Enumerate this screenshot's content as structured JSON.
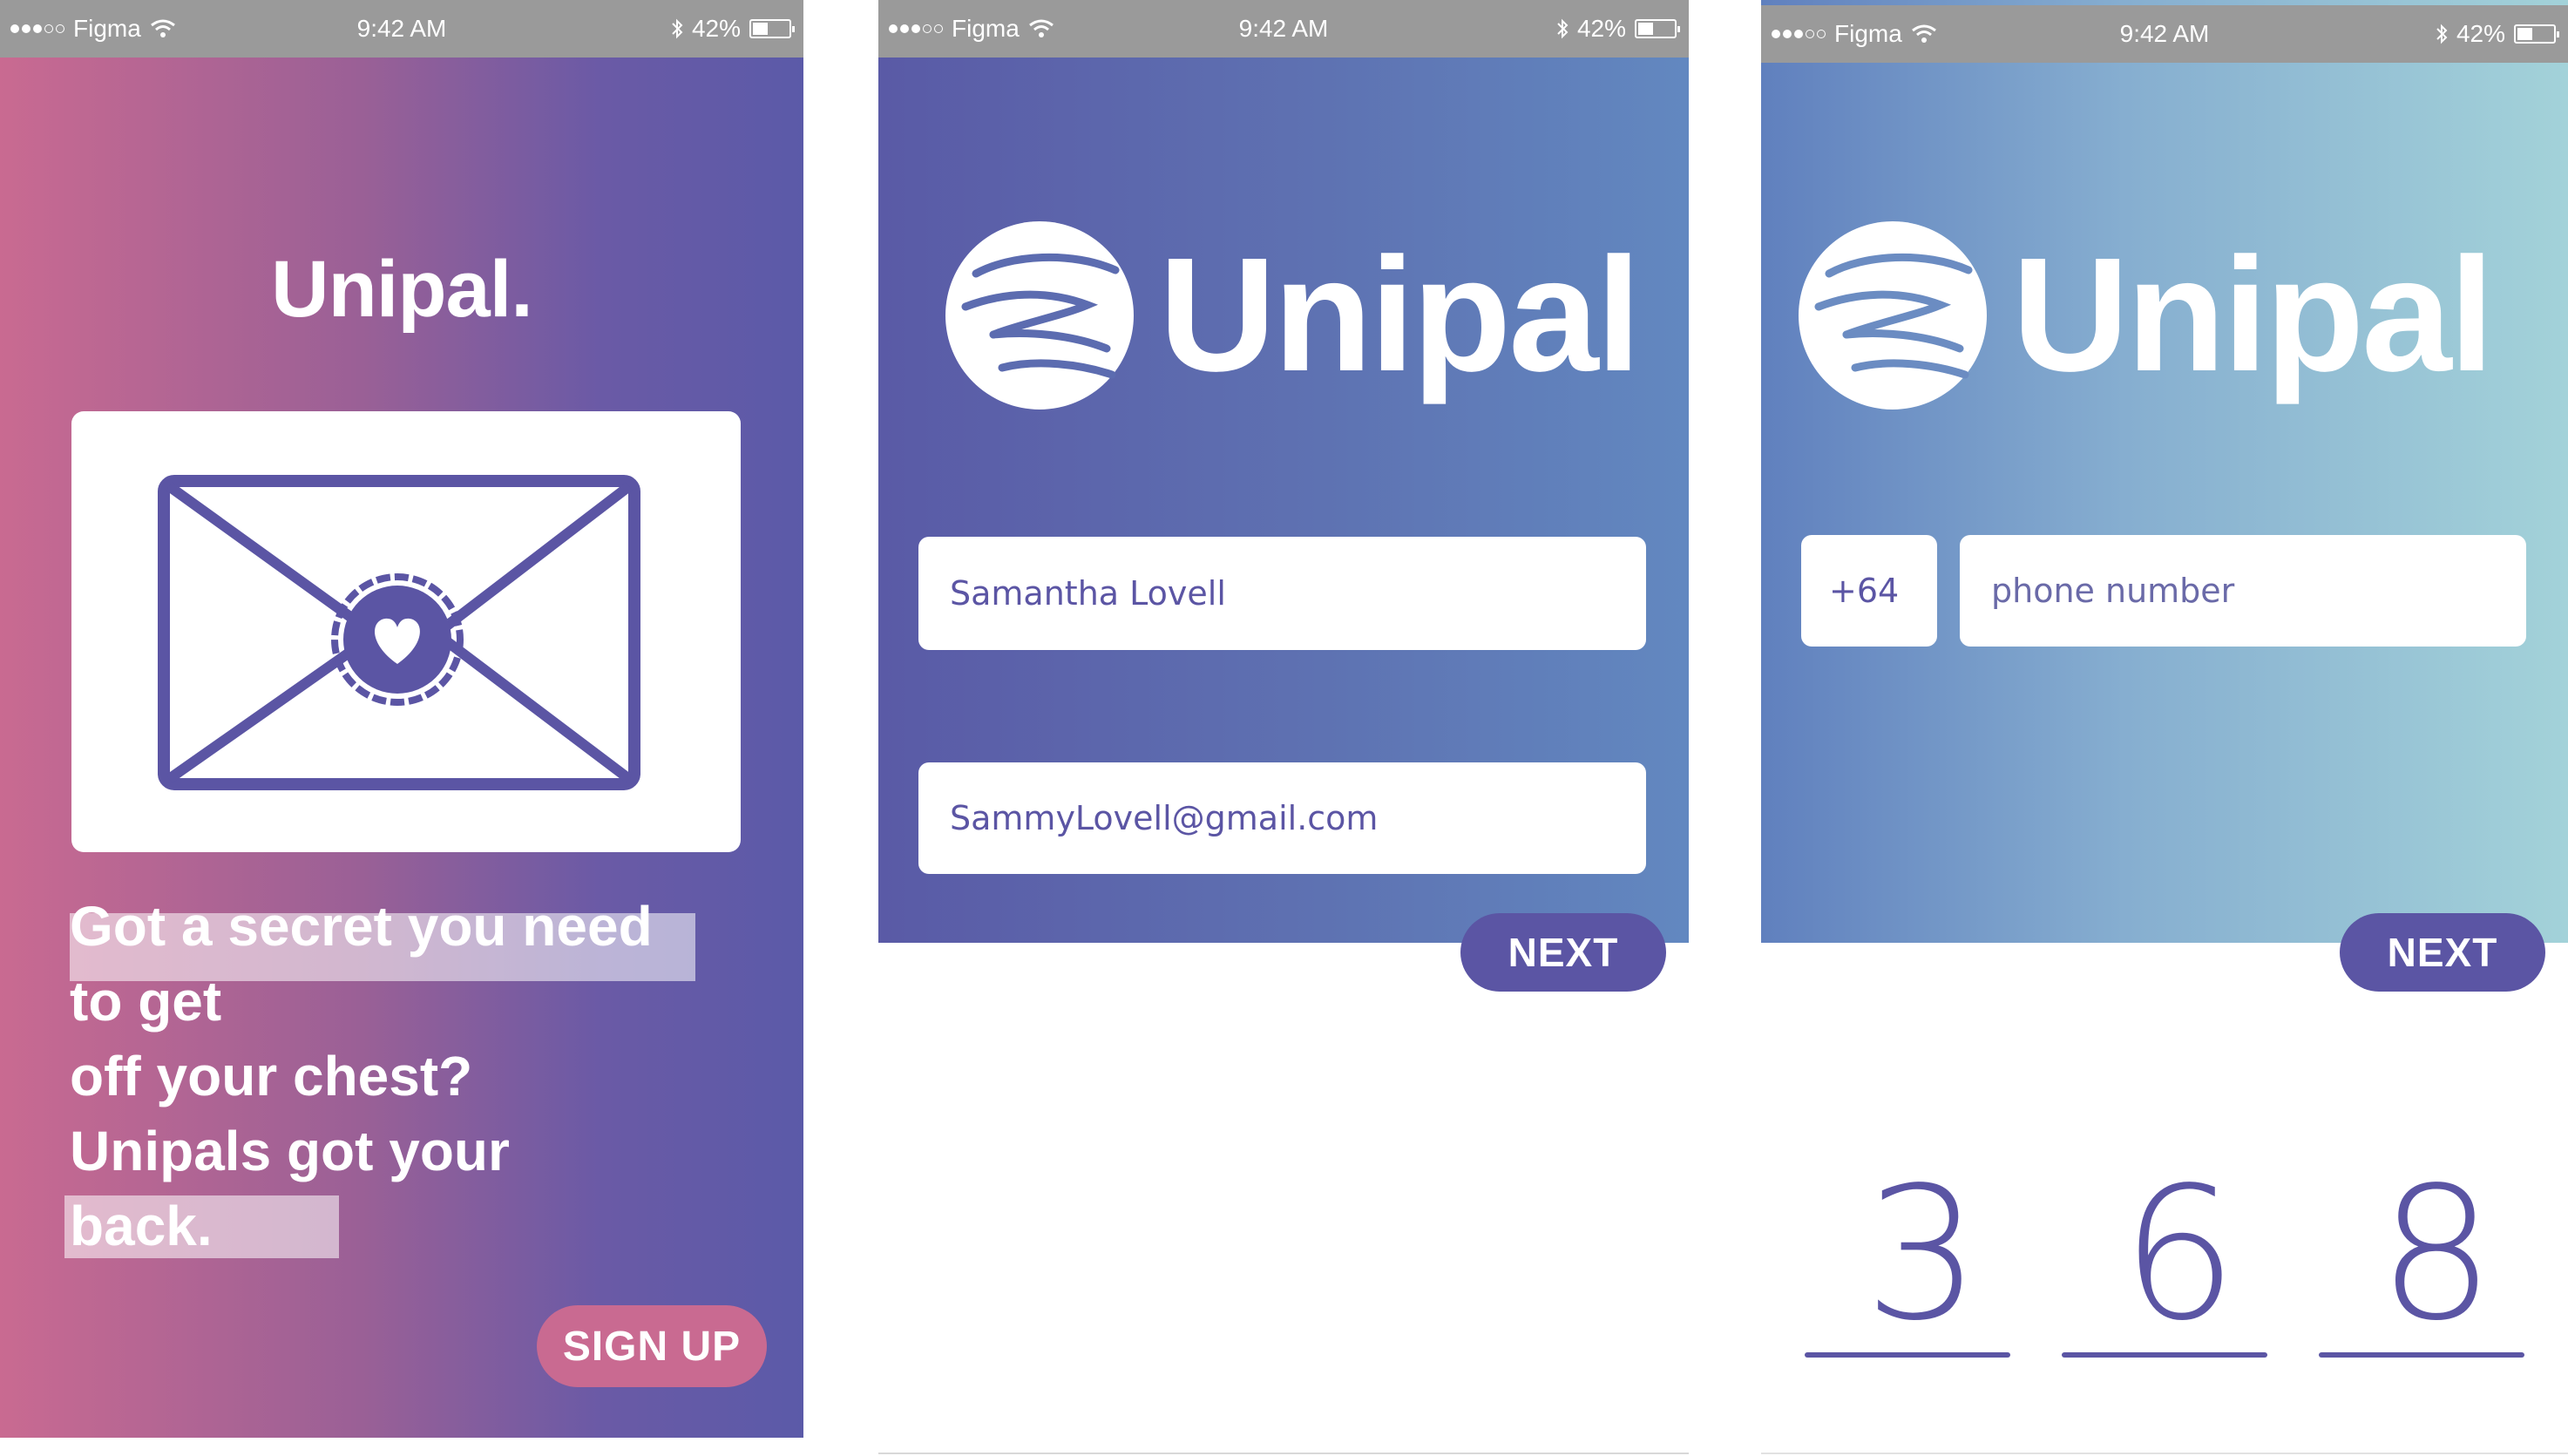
{
  "status_bar": {
    "carrier": "Figma",
    "time": "9:42 AM",
    "battery": "42%",
    "battery_level": 0.42
  },
  "screen1": {
    "title": "Unipal.",
    "tagline_lines": [
      "Got a secret you need",
      "to get",
      "off your chest?",
      "Unipals got your",
      "back."
    ],
    "signup_label": "SIGN UP",
    "colors": {
      "gradient_start": "#c96a91",
      "gradient_end": "#5b5aa8",
      "accent": "#5b55a4",
      "button": "#c96a91"
    },
    "icon": "envelope-heart-seal-icon"
  },
  "screen2": {
    "logo_text": "Unipal",
    "name_value": "Samantha Lovell",
    "email_value": "SammyLovell@gmail.com",
    "next_label": "NEXT",
    "icon": "globe-hands-logo-icon"
  },
  "screen3": {
    "logo_text": "Unipal",
    "country_code": "+64",
    "phone_placeholder": "phone number",
    "next_label": "NEXT",
    "code_digits": [
      "3",
      "6",
      "8"
    ]
  }
}
